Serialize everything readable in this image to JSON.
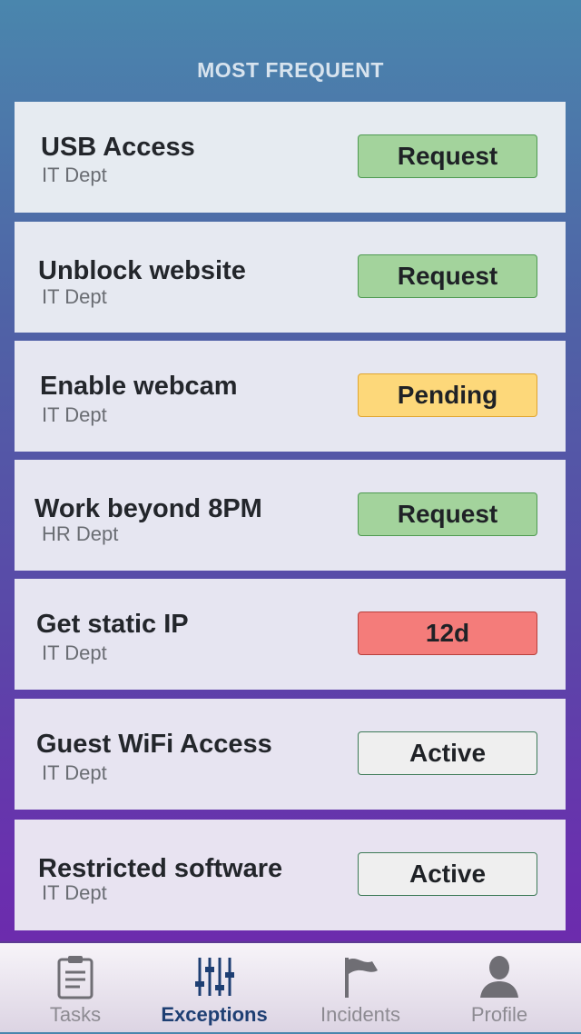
{
  "section_title": "MOST FREQUENT",
  "cards": [
    {
      "title": "USB Access",
      "dept": "IT Dept",
      "status": "Request"
    },
    {
      "title": "Unblock website",
      "dept": "IT Dept",
      "status": "Request"
    },
    {
      "title": "Enable webcam",
      "dept": "IT Dept",
      "status": "Pending"
    },
    {
      "title": "Work beyond 8PM",
      "dept": "HR Dept",
      "status": "Request"
    },
    {
      "title": "Get static IP",
      "dept": "IT Dept",
      "status": "12d"
    },
    {
      "title": "Guest WiFi Access",
      "dept": "IT Dept",
      "status": "Active"
    },
    {
      "title": "Restricted software",
      "dept": "IT Dept",
      "status": "Active"
    }
  ],
  "status_colors": {
    "request": {
      "bg": "#a3d39c",
      "border": "#4f9a52"
    },
    "pending": {
      "bg": "#fdd87a",
      "border": "#e0a530"
    },
    "overdue": {
      "bg": "#f47c7a",
      "border": "#b8403c"
    },
    "active": {
      "bg": "#efefef",
      "border": "#3d7a57"
    }
  },
  "tabbar": {
    "tabs": [
      {
        "label": "Tasks",
        "icon": "clipboard-icon",
        "active": false
      },
      {
        "label": "Exceptions",
        "icon": "sliders-icon",
        "active": true
      },
      {
        "label": "Incidents",
        "icon": "flag-icon",
        "active": false
      },
      {
        "label": "Profile",
        "icon": "person-icon",
        "active": false
      }
    ]
  }
}
